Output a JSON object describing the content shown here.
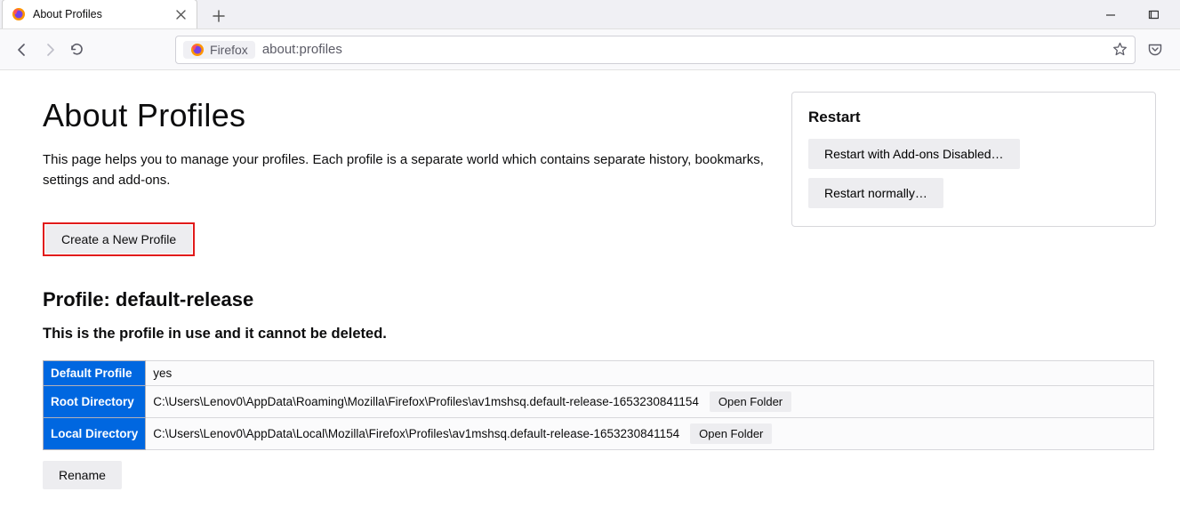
{
  "browser": {
    "tab_title": "About Profiles",
    "url_identity_label": "Firefox",
    "url": "about:profiles"
  },
  "page": {
    "heading": "About Profiles",
    "intro": "This page helps you to manage your profiles. Each profile is a separate world which contains separate history, bookmarks, settings and add-ons.",
    "create_button": "Create a New Profile"
  },
  "restart": {
    "heading": "Restart",
    "disabled_label": "Restart with Add-ons Disabled…",
    "normal_label": "Restart normally…"
  },
  "profile": {
    "title": "Profile: default-release",
    "in_use_note": "This is the profile in use and it cannot be deleted.",
    "rows": {
      "default_label": "Default Profile",
      "default_value": "yes",
      "root_label": "Root Directory",
      "root_value": "C:\\Users\\Lenov0\\AppData\\Roaming\\Mozilla\\Firefox\\Profiles\\av1mshsq.default-release-1653230841154",
      "local_label": "Local Directory",
      "local_value": "C:\\Users\\Lenov0\\AppData\\Local\\Mozilla\\Firefox\\Profiles\\av1mshsq.default-release-1653230841154",
      "open_folder": "Open Folder"
    },
    "rename_button": "Rename"
  }
}
